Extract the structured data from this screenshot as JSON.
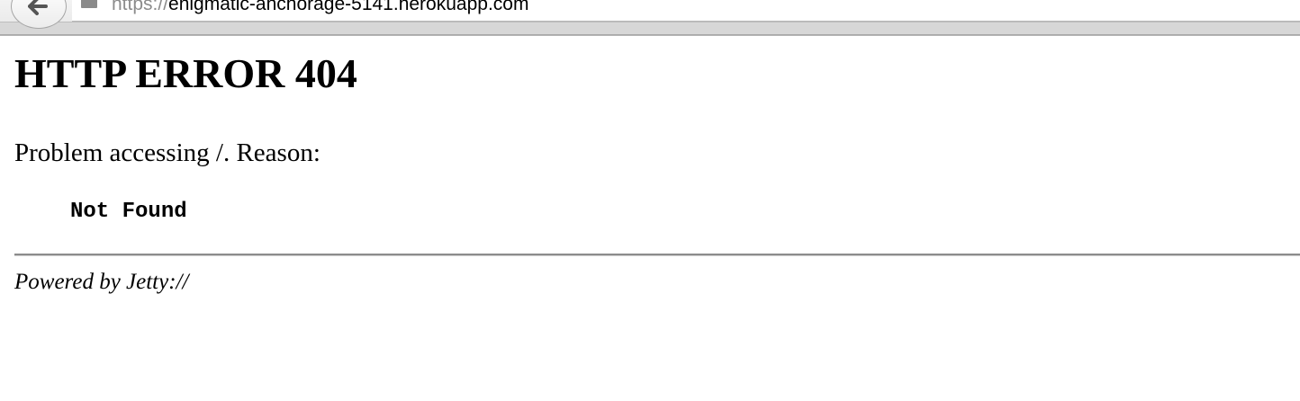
{
  "browser": {
    "url_scheme": "https://",
    "url_host": "enigmatic-anchorage-5141.herokuapp.com"
  },
  "page": {
    "heading": "HTTP ERROR 404",
    "problem_text": "Problem accessing /. Reason:",
    "reason": "Not Found",
    "footer": "Powered by Jetty://"
  },
  "icons": {
    "back": "back-arrow-icon",
    "site": "site-info-icon"
  }
}
